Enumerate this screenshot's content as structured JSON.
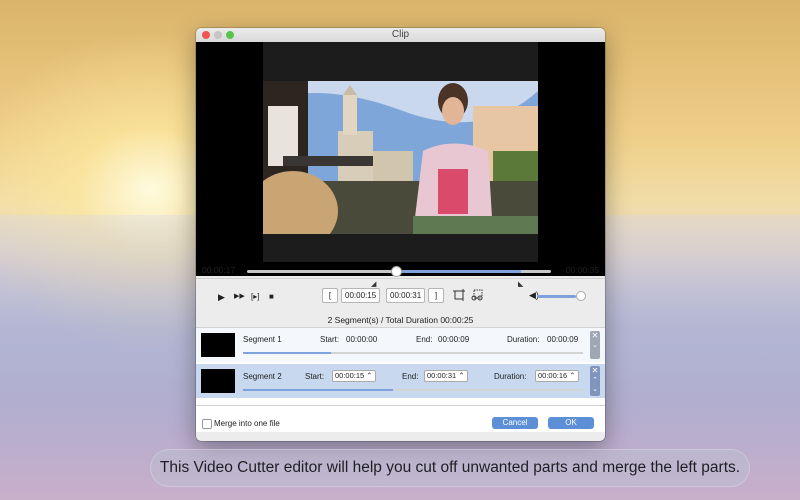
{
  "window": {
    "title": "Clip"
  },
  "timeline": {
    "current": "00:00:17",
    "total": "00:00:35",
    "progress": 0.49
  },
  "toolbar": {
    "play_icon": "▶",
    "next_icon": "▶▶",
    "frame_icon": "[▸]",
    "stop_icon": "■",
    "start_bracket": "[",
    "start_time": "00:00:15",
    "end_time": "00:00:31",
    "end_bracket": "]",
    "volume": 0.85
  },
  "summary": "2 Segment(s) / Total Duration 00:00:25",
  "segments": [
    {
      "label": "Segment 1",
      "start_label": "Start:",
      "start": "00:00:00",
      "end_label": "End:",
      "end": "00:00:09",
      "duration_label": "Duration:",
      "duration": "00:00:09",
      "fill": 0.26
    },
    {
      "label": "Segment 2",
      "start_label": "Start:",
      "start": "00:00:15",
      "end_label": "End:",
      "end": "00:00:31",
      "duration_label": "Duration:",
      "duration": "00:00:16",
      "fill": 0.44
    }
  ],
  "footer": {
    "merge_label": "Merge into one file",
    "cancel": "Cancel",
    "ok": "OK"
  },
  "caption": "This Video Cutter editor will help you cut off unwanted parts and  merge the left parts.",
  "colors": {
    "accent": "#5d8fd6",
    "selected_row": "#c8d8ef"
  }
}
